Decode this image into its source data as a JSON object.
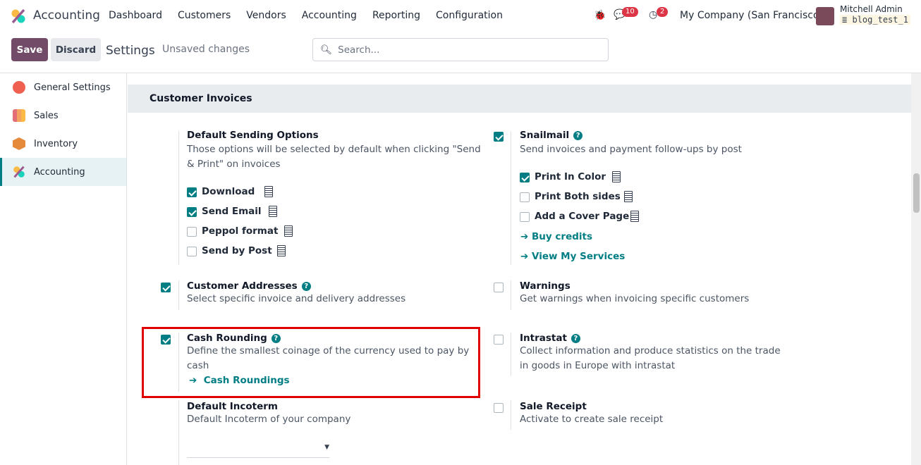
{
  "navbar": {
    "app_name": "Accounting",
    "menu": [
      "Dashboard",
      "Customers",
      "Vendors",
      "Accounting",
      "Reporting",
      "Configuration"
    ],
    "messages_count": "10",
    "activities_count": "2",
    "company": "My Company (San Francisco)",
    "user": "Mitchell Admin",
    "database": "blog_test_1"
  },
  "control_panel": {
    "save": "Save",
    "discard": "Discard",
    "title": "Settings",
    "status": "Unsaved changes",
    "search_placeholder": "Search..."
  },
  "sidebar": {
    "items": [
      {
        "label": "General Settings",
        "color": "#f06050"
      },
      {
        "label": "Sales",
        "color": "#e46e78"
      },
      {
        "label": "Inventory",
        "color": "#e58a3b"
      },
      {
        "label": "Accounting",
        "color": "#9c5b8f",
        "active": true
      }
    ]
  },
  "section": {
    "title": "Customer Invoices",
    "default_sending": {
      "title": "Default Sending Options",
      "desc": "Those options will be selected by default when clicking \"Send & Print\" on invoices",
      "options": [
        {
          "label": "Download",
          "checked": true
        },
        {
          "label": "Send Email",
          "checked": true
        },
        {
          "label": "Peppol format",
          "checked": false
        },
        {
          "label": "Send by Post",
          "checked": false
        }
      ]
    },
    "snailmail": {
      "title": "Snailmail",
      "checked": true,
      "desc": "Send invoices and payment follow-ups by post",
      "options": [
        {
          "label": "Print In Color",
          "checked": true
        },
        {
          "label": "Print Both sides",
          "checked": false
        },
        {
          "label": "Add a Cover Page",
          "checked": false
        }
      ],
      "links": [
        "Buy credits",
        "View My Services"
      ]
    },
    "customer_addresses": {
      "title": "Customer Addresses",
      "checked": true,
      "desc": "Select specific invoice and delivery addresses"
    },
    "warnings": {
      "title": "Warnings",
      "checked": false,
      "desc": "Get warnings when invoicing specific customers"
    },
    "cash_rounding": {
      "title": "Cash Rounding",
      "checked": true,
      "desc": "Define the smallest coinage of the currency used to pay by cash",
      "link": "Cash Roundings"
    },
    "intrastat": {
      "title": "Intrastat",
      "checked": false,
      "desc": "Collect information and produce statistics on the trade in goods in Europe with intrastat"
    },
    "incoterm": {
      "title": "Default Incoterm",
      "desc": "Default Incoterm of your company",
      "value": ""
    },
    "sale_receipt": {
      "title": "Sale Receipt",
      "checked": false,
      "desc": "Activate to create sale receipt"
    }
  },
  "help_glyph": "?",
  "arrow": "➔"
}
